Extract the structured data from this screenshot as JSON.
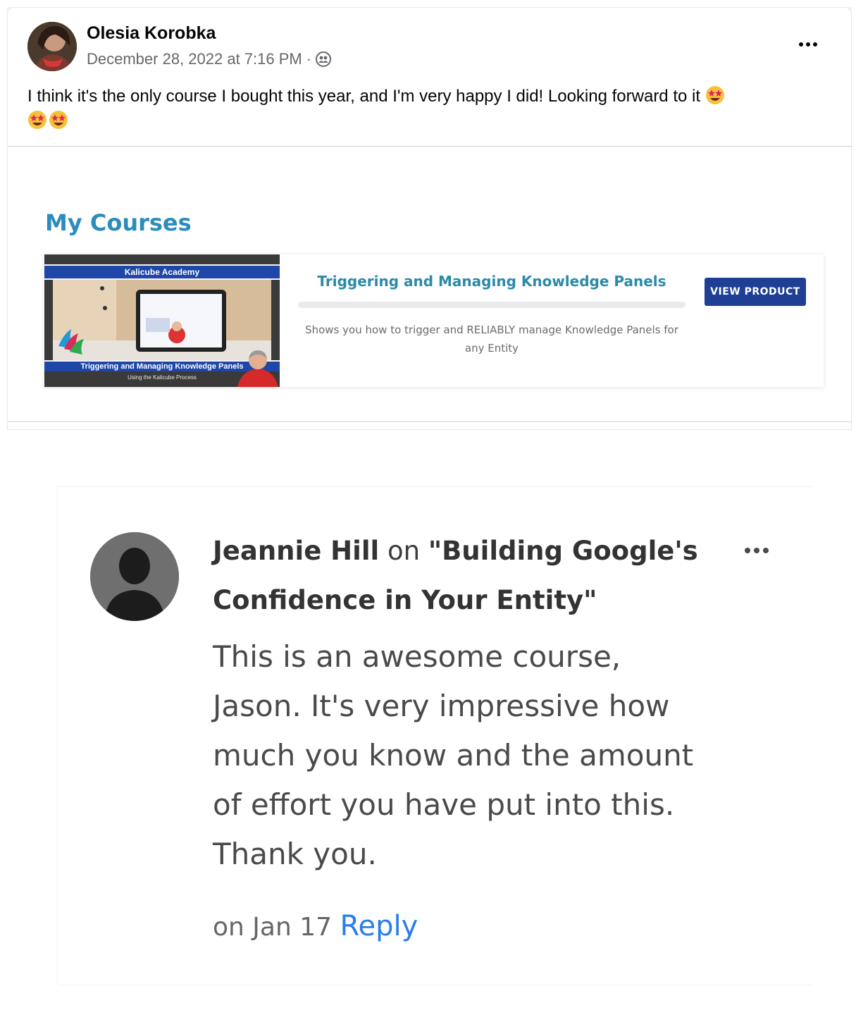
{
  "post": {
    "author": "Olesia Korobka",
    "timestamp": "December 28, 2022 at 7:16 PM",
    "separator": "·",
    "audience_icon": "friends-icon",
    "menu_icon": "more-options-icon",
    "text": "I think it's the only course I bought this year, and I'm very happy I did! Looking forward to it",
    "emoji": "star-struck-emoji",
    "course_section": {
      "heading": "My Courses",
      "thumbnail": {
        "top_banner": "Kalicube Academy",
        "bottom_banner": "Triggering and Managing Knowledge Panels",
        "subtitle": "Using the Kalicube Process"
      },
      "course_title": "Triggering and Managing Knowledge Panels",
      "description": "Shows you how to trigger and RELIABLY manage Knowledge Panels for any Entity",
      "button_label": "VIEW PRODUCT"
    }
  },
  "comment": {
    "author": "Jeannie Hill",
    "on_word": "on",
    "course": "\"Building Google's Confidence in Your Entity\"",
    "body": "This is an awesome course, Jason. It's very impressive how much you know and the amount of effort you have put into this. Thank you.",
    "date": "on Jan 17",
    "reply_label": "Reply",
    "menu_icon": "more-options-icon"
  },
  "colors": {
    "course_heading": "#2b8cbe",
    "button_bg": "#1e3f93",
    "reply_link": "#2b7de9"
  }
}
